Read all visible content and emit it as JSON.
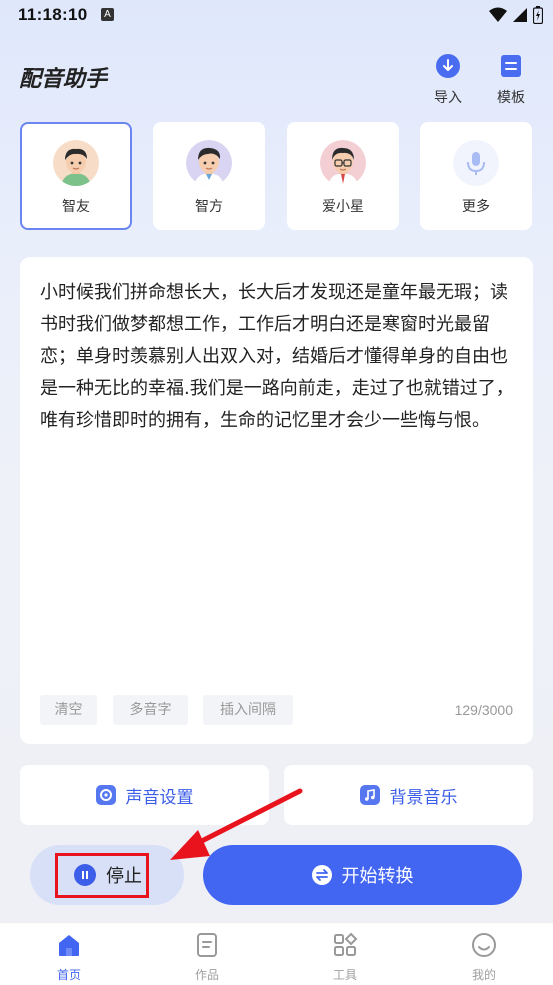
{
  "status_bar": {
    "time": "11:18:10",
    "badge": "A"
  },
  "header": {
    "title": "配音助手",
    "import_label": "导入",
    "template_label": "模板"
  },
  "voices": [
    {
      "label": "智友",
      "selected": true
    },
    {
      "label": "智方",
      "selected": false
    },
    {
      "label": "爱小星",
      "selected": false
    },
    {
      "label": "更多",
      "selected": false
    }
  ],
  "editor": {
    "text": "小时候我们拼命想长大，长大后才发现还是童年最无瑕；读书时我们做梦都想工作，工作后才明白还是寒窗时光最留恋；单身时羡慕别人出双入对，结婚后才懂得单身的自由也是一种无比的幸福.我们是一路向前走，走过了也就错过了，唯有珍惜即时的拥有，生命的记忆里才会少一些悔与恨。",
    "chips": [
      "清空",
      "多音字",
      "插入间隔"
    ],
    "counter": "129/3000"
  },
  "settings": {
    "voice_settings_label": "声音设置",
    "bg_music_label": "背景音乐"
  },
  "actions": {
    "stop_label": "停止",
    "convert_label": "开始转换"
  },
  "nav": {
    "home": "首页",
    "works": "作品",
    "tools": "工具",
    "me": "我的"
  },
  "colors": {
    "accent": "#4265f2",
    "highlight_red": "#e8131d"
  }
}
